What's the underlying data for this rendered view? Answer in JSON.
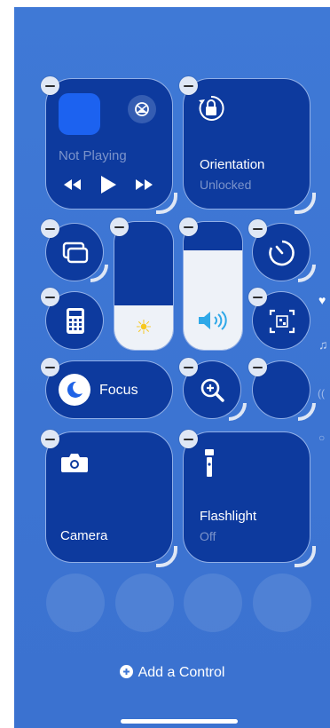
{
  "now_playing": {
    "status": "Not Playing",
    "prev_icon": "rewind-icon",
    "play_icon": "play-icon",
    "next_icon": "fast-forward-icon"
  },
  "orientation": {
    "title": "Orientation",
    "status": "Unlocked"
  },
  "focus": {
    "label": "Focus"
  },
  "camera": {
    "label": "Camera"
  },
  "flashlight": {
    "label": "Flashlight",
    "status": "Off"
  },
  "footer": {
    "add_control": "Add a Control"
  },
  "sliders": {
    "brightness_level": 0.35,
    "volume_level": 0.78
  },
  "colors": {
    "background": "#3d76d4",
    "tile": "#0d3a9e",
    "accent": "#1f63e6"
  }
}
